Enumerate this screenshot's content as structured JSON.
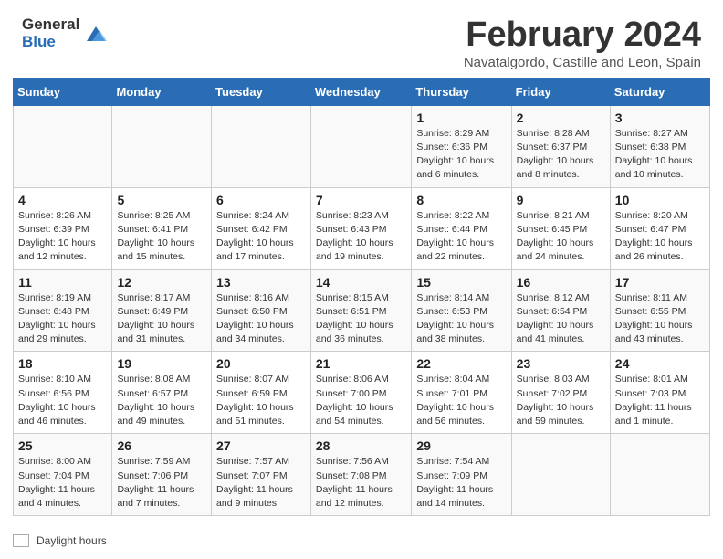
{
  "header": {
    "logo_general": "General",
    "logo_blue": "Blue",
    "month_title": "February 2024",
    "subtitle": "Navatalgordo, Castille and Leon, Spain"
  },
  "footer": {
    "label": "Daylight hours"
  },
  "days_of_week": [
    "Sunday",
    "Monday",
    "Tuesday",
    "Wednesday",
    "Thursday",
    "Friday",
    "Saturday"
  ],
  "weeks": [
    [
      {
        "num": "",
        "info": ""
      },
      {
        "num": "",
        "info": ""
      },
      {
        "num": "",
        "info": ""
      },
      {
        "num": "",
        "info": ""
      },
      {
        "num": "1",
        "info": "Sunrise: 8:29 AM\nSunset: 6:36 PM\nDaylight: 10 hours\nand 6 minutes."
      },
      {
        "num": "2",
        "info": "Sunrise: 8:28 AM\nSunset: 6:37 PM\nDaylight: 10 hours\nand 8 minutes."
      },
      {
        "num": "3",
        "info": "Sunrise: 8:27 AM\nSunset: 6:38 PM\nDaylight: 10 hours\nand 10 minutes."
      }
    ],
    [
      {
        "num": "4",
        "info": "Sunrise: 8:26 AM\nSunset: 6:39 PM\nDaylight: 10 hours\nand 12 minutes."
      },
      {
        "num": "5",
        "info": "Sunrise: 8:25 AM\nSunset: 6:41 PM\nDaylight: 10 hours\nand 15 minutes."
      },
      {
        "num": "6",
        "info": "Sunrise: 8:24 AM\nSunset: 6:42 PM\nDaylight: 10 hours\nand 17 minutes."
      },
      {
        "num": "7",
        "info": "Sunrise: 8:23 AM\nSunset: 6:43 PM\nDaylight: 10 hours\nand 19 minutes."
      },
      {
        "num": "8",
        "info": "Sunrise: 8:22 AM\nSunset: 6:44 PM\nDaylight: 10 hours\nand 22 minutes."
      },
      {
        "num": "9",
        "info": "Sunrise: 8:21 AM\nSunset: 6:45 PM\nDaylight: 10 hours\nand 24 minutes."
      },
      {
        "num": "10",
        "info": "Sunrise: 8:20 AM\nSunset: 6:47 PM\nDaylight: 10 hours\nand 26 minutes."
      }
    ],
    [
      {
        "num": "11",
        "info": "Sunrise: 8:19 AM\nSunset: 6:48 PM\nDaylight: 10 hours\nand 29 minutes."
      },
      {
        "num": "12",
        "info": "Sunrise: 8:17 AM\nSunset: 6:49 PM\nDaylight: 10 hours\nand 31 minutes."
      },
      {
        "num": "13",
        "info": "Sunrise: 8:16 AM\nSunset: 6:50 PM\nDaylight: 10 hours\nand 34 minutes."
      },
      {
        "num": "14",
        "info": "Sunrise: 8:15 AM\nSunset: 6:51 PM\nDaylight: 10 hours\nand 36 minutes."
      },
      {
        "num": "15",
        "info": "Sunrise: 8:14 AM\nSunset: 6:53 PM\nDaylight: 10 hours\nand 38 minutes."
      },
      {
        "num": "16",
        "info": "Sunrise: 8:12 AM\nSunset: 6:54 PM\nDaylight: 10 hours\nand 41 minutes."
      },
      {
        "num": "17",
        "info": "Sunrise: 8:11 AM\nSunset: 6:55 PM\nDaylight: 10 hours\nand 43 minutes."
      }
    ],
    [
      {
        "num": "18",
        "info": "Sunrise: 8:10 AM\nSunset: 6:56 PM\nDaylight: 10 hours\nand 46 minutes."
      },
      {
        "num": "19",
        "info": "Sunrise: 8:08 AM\nSunset: 6:57 PM\nDaylight: 10 hours\nand 49 minutes."
      },
      {
        "num": "20",
        "info": "Sunrise: 8:07 AM\nSunset: 6:59 PM\nDaylight: 10 hours\nand 51 minutes."
      },
      {
        "num": "21",
        "info": "Sunrise: 8:06 AM\nSunset: 7:00 PM\nDaylight: 10 hours\nand 54 minutes."
      },
      {
        "num": "22",
        "info": "Sunrise: 8:04 AM\nSunset: 7:01 PM\nDaylight: 10 hours\nand 56 minutes."
      },
      {
        "num": "23",
        "info": "Sunrise: 8:03 AM\nSunset: 7:02 PM\nDaylight: 10 hours\nand 59 minutes."
      },
      {
        "num": "24",
        "info": "Sunrise: 8:01 AM\nSunset: 7:03 PM\nDaylight: 11 hours\nand 1 minute."
      }
    ],
    [
      {
        "num": "25",
        "info": "Sunrise: 8:00 AM\nSunset: 7:04 PM\nDaylight: 11 hours\nand 4 minutes."
      },
      {
        "num": "26",
        "info": "Sunrise: 7:59 AM\nSunset: 7:06 PM\nDaylight: 11 hours\nand 7 minutes."
      },
      {
        "num": "27",
        "info": "Sunrise: 7:57 AM\nSunset: 7:07 PM\nDaylight: 11 hours\nand 9 minutes."
      },
      {
        "num": "28",
        "info": "Sunrise: 7:56 AM\nSunset: 7:08 PM\nDaylight: 11 hours\nand 12 minutes."
      },
      {
        "num": "29",
        "info": "Sunrise: 7:54 AM\nSunset: 7:09 PM\nDaylight: 11 hours\nand 14 minutes."
      },
      {
        "num": "",
        "info": ""
      },
      {
        "num": "",
        "info": ""
      }
    ]
  ]
}
